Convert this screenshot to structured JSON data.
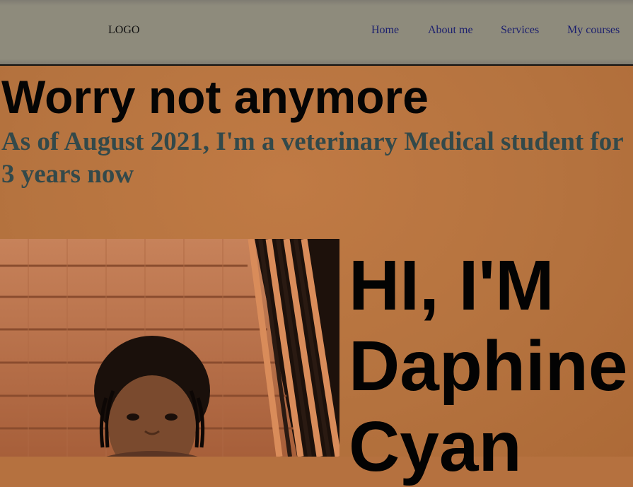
{
  "nav": {
    "logo": "LOGO",
    "links": [
      "Home",
      "About me",
      "Services",
      "My courses"
    ]
  },
  "hero": {
    "headline": "Worry not anymore",
    "subheadline": "As of August 2021, I'm a veterinary Medical student for 3 years now",
    "greeting_lines": [
      "HI, I'M",
      "Daphine",
      "Cyan"
    ]
  },
  "colors": {
    "nav_background": "#8e8b7c",
    "page_background": "#b5713f",
    "headline": "#050505",
    "subheadline": "#33494a",
    "nav_link": "#1b1f6e"
  },
  "photo": {
    "icon": "profile-photo"
  }
}
